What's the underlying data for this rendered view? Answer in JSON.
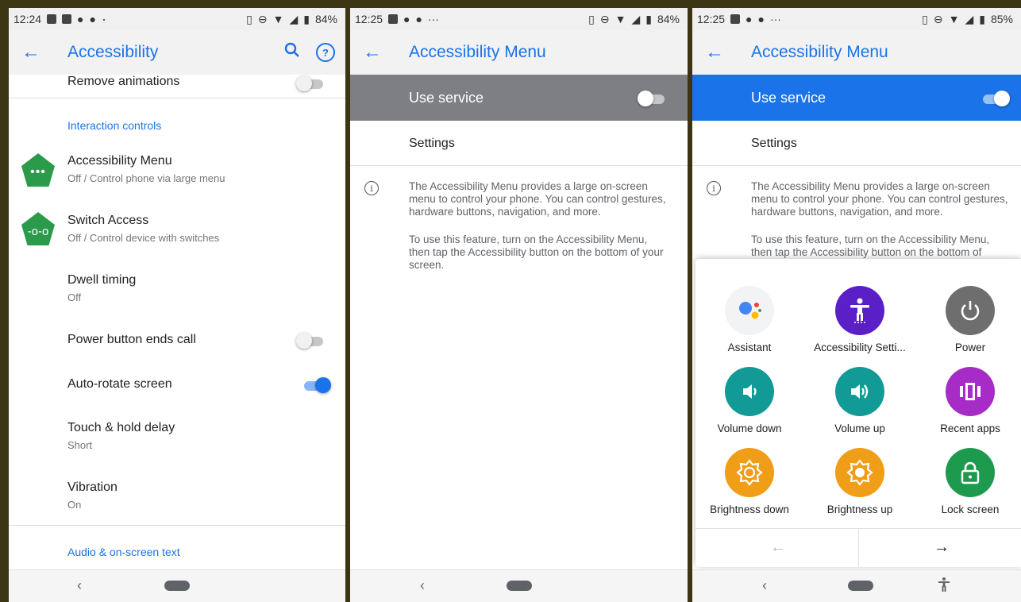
{
  "phones": [
    {
      "status": {
        "time": "12:24",
        "battery": "84%"
      },
      "title": "Accessibility",
      "rows": {
        "remove_animations": "Remove animations",
        "section_interaction": "Interaction controls",
        "acc_menu_title": "Accessibility Menu",
        "acc_menu_sub": "Off / Control phone via large menu",
        "switch_title": "Switch Access",
        "switch_sub": "Off / Control device with switches",
        "dwell_title": "Dwell timing",
        "dwell_sub": "Off",
        "power_call": "Power button ends call",
        "auto_rotate": "Auto-rotate screen",
        "touch_title": "Touch & hold delay",
        "touch_sub": "Short",
        "vibration_title": "Vibration",
        "vibration_sub": "On",
        "section_audio": "Audio & on-screen text"
      }
    },
    {
      "status": {
        "time": "12:25",
        "battery": "84%"
      },
      "title": "Accessibility Menu",
      "use_service": "Use service",
      "settings": "Settings",
      "info1": "The Accessibility Menu provides a large on-screen menu to control your phone. You can control gestures, hardware buttons, navigation, and more.",
      "info2": "To use this feature, turn on the Accessibility Menu, then tap the Accessibility button on the bottom of your screen."
    },
    {
      "status": {
        "time": "12:25",
        "battery": "85%"
      },
      "title": "Accessibility Menu",
      "use_service": "Use service",
      "settings": "Settings",
      "info1": "The Accessibility Menu provides a large on-screen menu to control your phone. You can control gestures, hardware buttons, navigation, and more.",
      "info2": "To use this feature, turn on the Accessibility Menu, then tap the Accessibility button on the bottom of",
      "menu": [
        {
          "label": "Assistant",
          "icon": "assistant-icon",
          "color": "#f1f3f4"
        },
        {
          "label": "Accessibility Setti...",
          "icon": "accessibility-icon",
          "color": "#5a1fc6"
        },
        {
          "label": "Power",
          "icon": "power-icon",
          "color": "#6e6e6e"
        },
        {
          "label": "Volume down",
          "icon": "volume-down-icon",
          "color": "#129a97"
        },
        {
          "label": "Volume up",
          "icon": "volume-up-icon",
          "color": "#129a97"
        },
        {
          "label": "Recent apps",
          "icon": "recent-apps-icon",
          "color": "#a72bc6"
        },
        {
          "label": "Brightness down",
          "icon": "brightness-down-icon",
          "color": "#f09d17"
        },
        {
          "label": "Brightness up",
          "icon": "brightness-up-icon",
          "color": "#f09d17"
        },
        {
          "label": "Lock screen",
          "icon": "lock-icon",
          "color": "#1e9a4e"
        }
      ]
    }
  ],
  "colors": {
    "accent": "#1a73e8",
    "service_off": "#7d7f85",
    "service_on": "#1a73e8"
  }
}
